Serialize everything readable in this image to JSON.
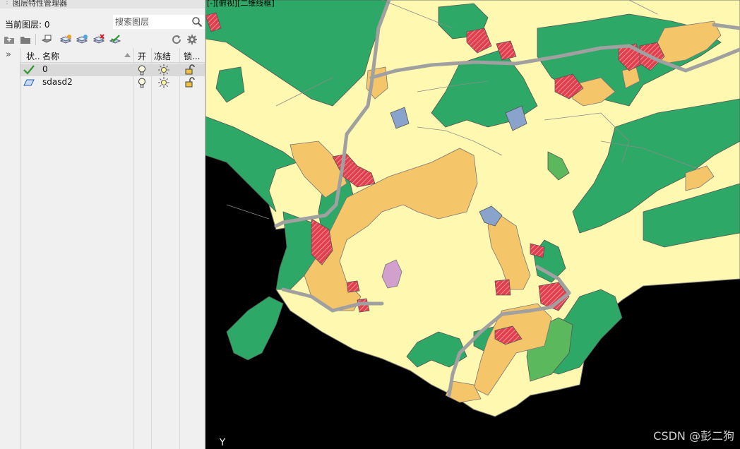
{
  "palette": {
    "title": "图层特性管理器",
    "current_layer": "当前图层: 0",
    "search_placeholder": "搜索图层",
    "toolbar": [
      "new-group-filter-icon",
      "new-property-filter-icon",
      "layer-states-icon",
      "new-layer-icon",
      "new-layer-frozen-vp-icon",
      "delete-layer-icon",
      "set-current-icon",
      "refresh-icon",
      "settings-icon"
    ]
  },
  "table": {
    "columns": {
      "status": "状..",
      "name": "名称",
      "on": "开",
      "freeze": "冻结",
      "lock": "锁..."
    },
    "rows": [
      {
        "status_icon": "current-check-icon",
        "name": "0",
        "selected": true
      },
      {
        "status_icon": "layer-icon",
        "name": "sdasd2",
        "selected": false
      }
    ]
  },
  "map": {
    "viewport_label": "[-][俯视][二维线框]",
    "ucs_label": "Y",
    "watermark": "CSDN @彭二狗",
    "colors": {
      "sea": "#000000",
      "land": "#fff8b0",
      "forest": "#2ea866",
      "grass": "#5cb85c",
      "orchard": "#f5c56a",
      "water": "#8aa3cc",
      "urban": "#e0404e",
      "special": "#d1a0cc",
      "road": "#a0a0a0",
      "boundary": "#777777"
    }
  }
}
